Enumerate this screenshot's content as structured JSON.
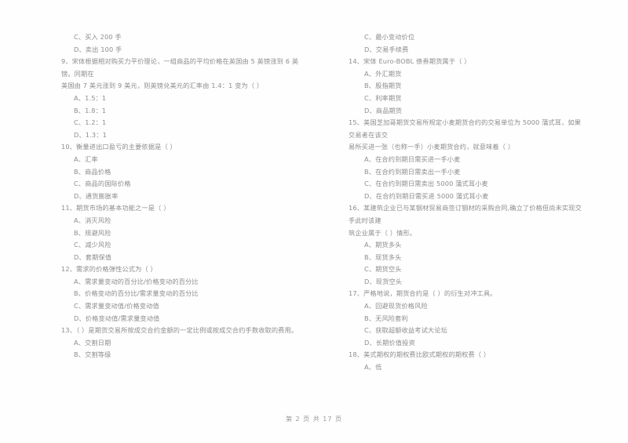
{
  "document": {
    "type": "scanned-exam-paper",
    "footer": "第 2 页 共 17 页",
    "text_color": "#8d8d8d",
    "background_color": "#ffffff"
  },
  "left_column": [
    {
      "id": "q8-options-tail",
      "lines": [],
      "options": [
        "C、买入 200 手",
        "D、卖出 100 手"
      ]
    },
    {
      "id": "q9",
      "lines": [
        "9、宋体根据相对购买力平价理论，一组商品的平均价格在英国由 5 英镑涨到 6 英镑。同期在",
        "美国由 7 美元涨到 9 美元，则英镑兑美元的汇率由 1.4：1 变为（      ）"
      ],
      "options": [
        "A、1.5：1",
        "B、1.8：1",
        "C、1.2：1",
        "D、1.3：1"
      ]
    },
    {
      "id": "q10",
      "lines": [
        "10、衡量进出口盈亏的主要依据是（      ）"
      ],
      "options": [
        "A、汇率",
        "B、商品价格",
        "C、商品的国际价格",
        "D、通货膨胀率"
      ]
    },
    {
      "id": "q11",
      "lines": [
        "11、期货市场的基本功能之一是（      ）"
      ],
      "options": [
        "A、消灭风险",
        "B、规避风险",
        "C、减少风险",
        "D、套期保值"
      ]
    },
    {
      "id": "q12",
      "lines": [
        "12、需求的价格弹性公式为（      ）"
      ],
      "options": [
        "A、需求量变动的百分比/价格变动的百分比",
        "B、价格变动的百分比/需求量变动的百分比",
        "C、需求量变动值/价格变动值",
        "D、价格变动值/需求量变动值"
      ]
    },
    {
      "id": "q13",
      "lines": [
        "13、（      ）是期货交易所按成交合约金额的一定比例或按成交合约手数收取的费用。"
      ],
      "options": [
        "A、交割日期",
        "B、交割等级"
      ]
    }
  ],
  "right_column": [
    {
      "id": "q13-options-tail",
      "lines": [],
      "options": [
        "C、最小变动价位",
        "D、交易手续费"
      ]
    },
    {
      "id": "q14",
      "lines": [
        "14、宋体 Euro-BOBL 债券期货属于（      ）"
      ],
      "options": [
        "A、外汇期货",
        "B、股指期货",
        "C、利率期货",
        "D、商品期货"
      ]
    },
    {
      "id": "q15",
      "lines": [
        "15、美国芝加哥期货交易所规定小麦期货合约的交易单位为 5000 蒲式耳，如果交易者在该交",
        "易所买进一张（也称一手）小麦期货合约，就意味着（      ）"
      ],
      "options": [
        "A、在合约到期日需买进一手小麦",
        "B、在合约到期日需卖出一手小麦",
        "C、在合约到期日需卖出 5000 蒲式耳小麦",
        "D、在合约到期日需买进 5000 蒲式耳小麦"
      ]
    },
    {
      "id": "q16",
      "lines": [
        "16、某建筑企业已与某钢材贸易商签订钢材的采购合同,确立了价格但尚未实现交手此时该建",
        "筑企业属于（      ）情形。"
      ],
      "options": [
        "A、期货多头",
        "B、现货多头",
        "C、期货空头",
        "D、现货空头"
      ]
    },
    {
      "id": "q17",
      "lines": [
        "17、严格地说，期货合约是（      ）的衍生对冲工具。"
      ],
      "options": [
        "A、回避现货价格风险",
        "B、无风险套利",
        "C、获取超额收益考试大论坛",
        "D、长期价值投资"
      ]
    },
    {
      "id": "q18",
      "lines": [
        "18、美式期权的期权费比欧式期权的期权费（      ）"
      ],
      "options": [
        "A、低"
      ]
    }
  ]
}
